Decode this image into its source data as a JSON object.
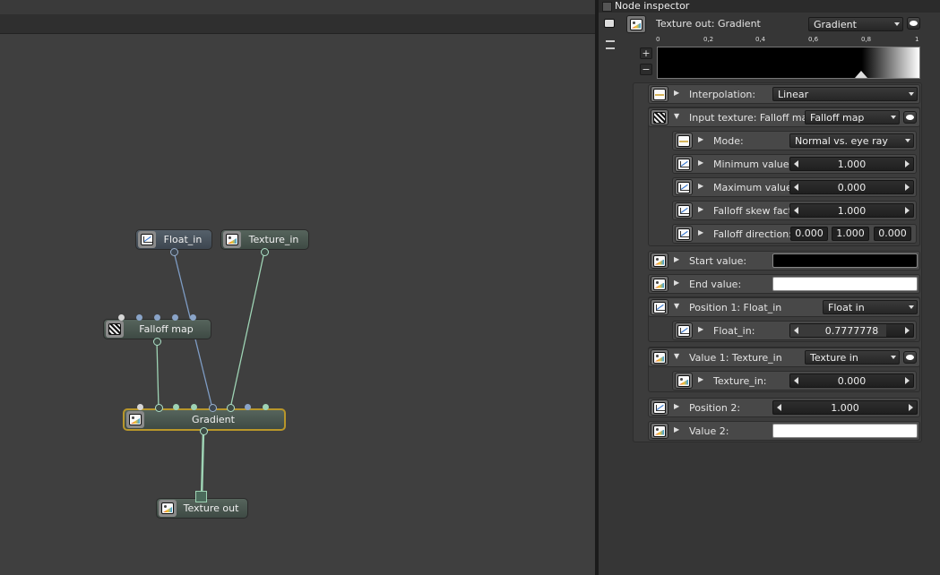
{
  "graph": {
    "nodes": [
      {
        "name": "float-in-node",
        "label": "Float_in",
        "icon": "float-icon"
      },
      {
        "name": "texture-in-node",
        "label": "Texture_in",
        "icon": "texture-icon"
      },
      {
        "name": "falloff-map-node",
        "label": "Falloff map",
        "icon": "falloff-icon"
      },
      {
        "name": "gradient-node",
        "label": "Gradient",
        "icon": "texture-icon"
      },
      {
        "name": "texture-out-node",
        "label": "Texture out",
        "icon": "texture-icon"
      }
    ]
  },
  "inspector": {
    "title": "Node inspector",
    "header": {
      "label": "Texture out: Gradient",
      "dropdown": "Gradient"
    },
    "ticks": [
      "0",
      "0,2",
      "0,4",
      "0,6",
      "0,8",
      "1"
    ],
    "plus": "+",
    "minus": "−",
    "rows": {
      "interpolation": {
        "label": "Interpolation:",
        "value": "Linear"
      },
      "input_texture": {
        "label": "Input texture: Falloff map",
        "value": "Falloff map"
      },
      "mode": {
        "label": "Mode:",
        "value": "Normal vs. eye ray"
      },
      "min_value": {
        "label": "Minimum value:",
        "value": "1.000"
      },
      "max_value": {
        "label": "Maximum value:",
        "value": "0.000"
      },
      "skew": {
        "label": "Falloff skew factor:",
        "value": "1.000"
      },
      "direction": {
        "label": "Falloff direction:",
        "x": "0.000",
        "y": "1.000",
        "z": "0.000"
      },
      "start_value": {
        "label": "Start value:",
        "color": "#000000"
      },
      "end_value": {
        "label": "End value:",
        "color": "#ffffff"
      },
      "position1": {
        "label": "Position 1: Float_in",
        "value": "Float in"
      },
      "float_in": {
        "label": "Float_in:",
        "value": "0.7777778",
        "fill": 0.78
      },
      "value1": {
        "label": "Value 1: Texture_in",
        "value": "Texture in"
      },
      "texture_in": {
        "label": "Texture_in:",
        "value": "0.000"
      },
      "position2": {
        "label": "Position 2:",
        "value": "1.000"
      },
      "value2": {
        "label": "Value 2:",
        "color": "#ffffff"
      }
    }
  }
}
